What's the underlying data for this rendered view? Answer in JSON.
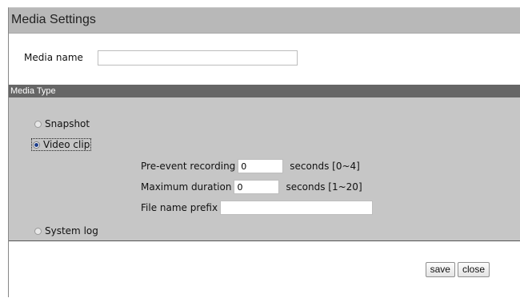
{
  "title": "Media Settings",
  "media_name": {
    "label": "Media name",
    "value": ""
  },
  "media_type": {
    "header": "Media Type",
    "options": [
      {
        "label": "Snapshot",
        "checked": false
      },
      {
        "label": "Video clip",
        "checked": true
      },
      {
        "label": "System log",
        "checked": false
      }
    ],
    "video_clip": {
      "pre_event_label": "Pre-event recording",
      "pre_event_value": "0",
      "pre_event_unit": "seconds [0~4]",
      "max_duration_label": "Maximum duration",
      "max_duration_value": "0",
      "max_duration_unit": "seconds [1~20]",
      "prefix_label": "File name prefix",
      "prefix_value": ""
    }
  },
  "buttons": {
    "save": "save",
    "close": "close"
  }
}
